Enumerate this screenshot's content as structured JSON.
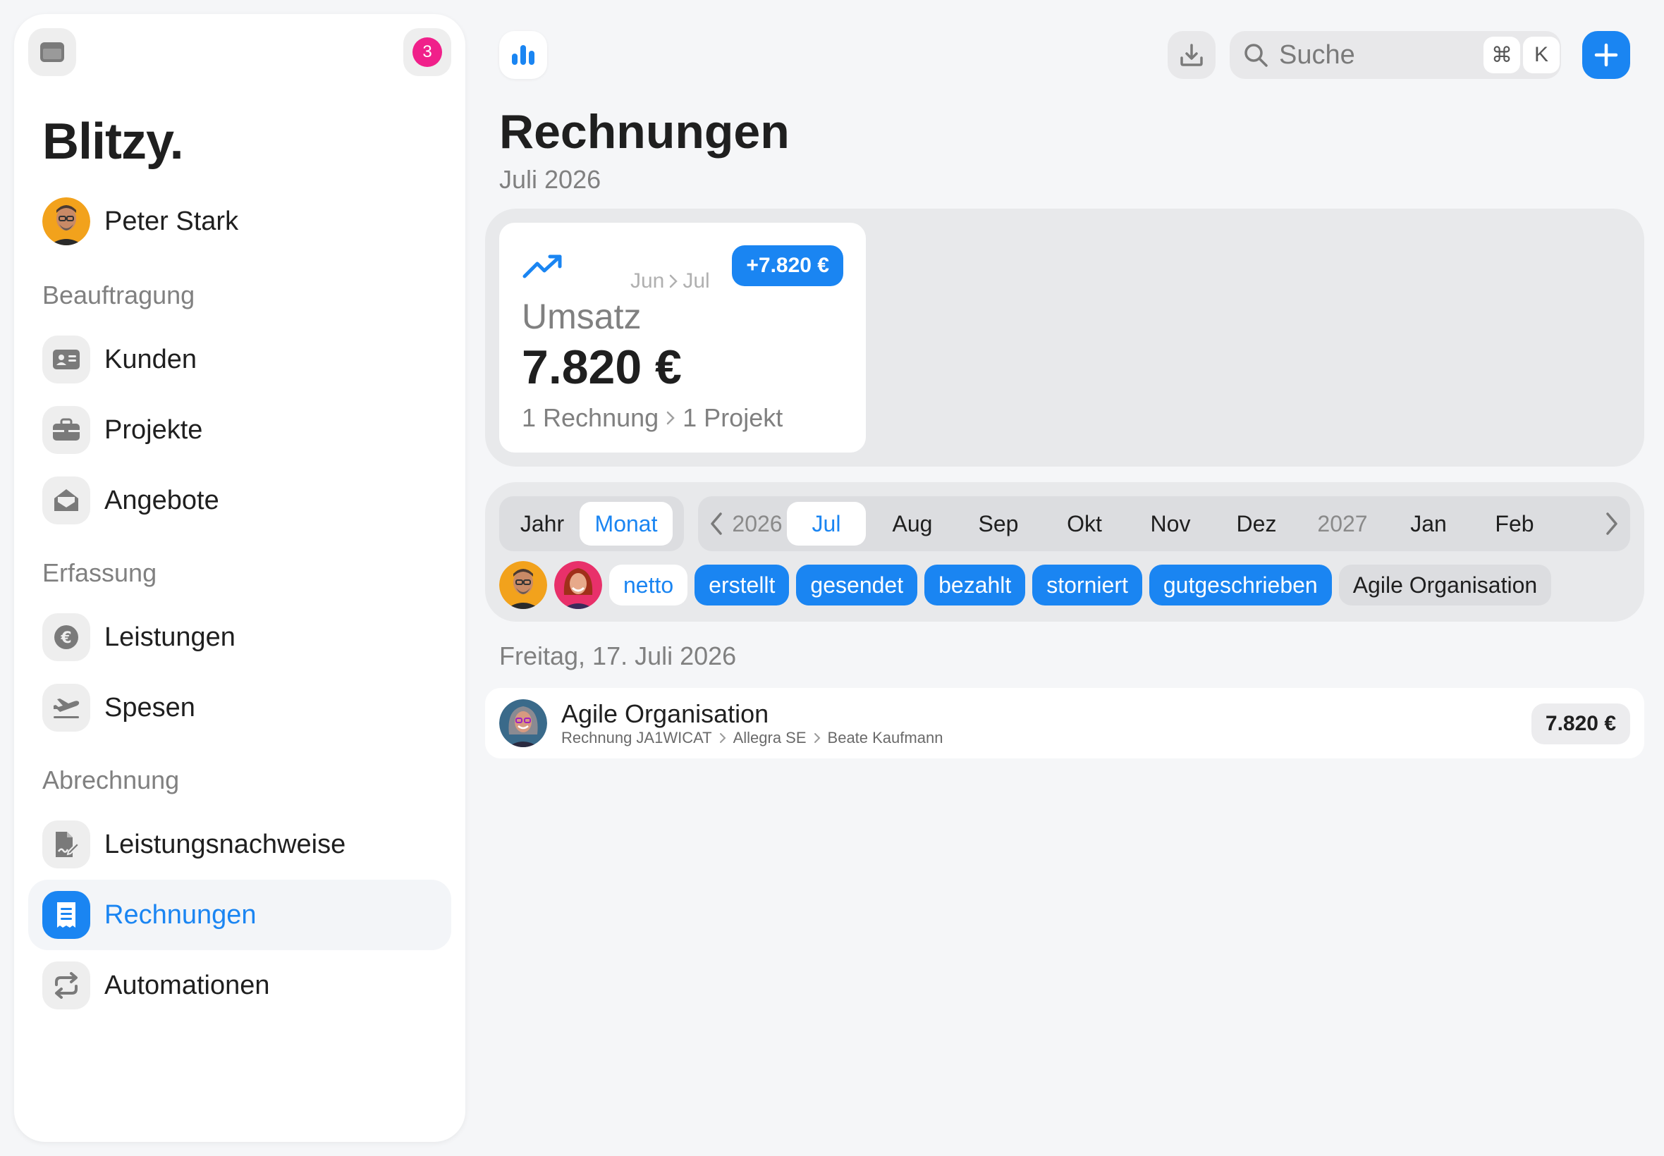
{
  "sidebar": {
    "notification_count": "3",
    "brand": "Blitzy.",
    "user_name": "Peter Stark",
    "sections": {
      "beauftragung": "Beauftragung",
      "erfassung": "Erfassung",
      "abrechnung": "Abrechnung"
    },
    "items": {
      "kunden": "Kunden",
      "projekte": "Projekte",
      "angebote": "Angebote",
      "leistungen": "Leistungen",
      "spesen": "Spesen",
      "leistungsnachweise": "Leistungsnachweise",
      "rechnungen": "Rechnungen",
      "automationen": "Automationen"
    },
    "active_item": "rechnungen"
  },
  "topbar": {
    "search_placeholder": "Suche",
    "shortcut_modifier": "⌘",
    "shortcut_key": "K"
  },
  "header": {
    "title": "Rechnungen",
    "subtitle": "Juli 2026"
  },
  "kpi": {
    "period_from": "Jun",
    "period_to": "Jul",
    "delta": "+7.820 €",
    "label": "Umsatz",
    "value": "7.820 €",
    "count_invoices": "1 Rechnung",
    "count_projects": "1 Projekt"
  },
  "filters": {
    "granularity": [
      "Jahr",
      "Monat"
    ],
    "selected_granularity": "Monat",
    "months": [
      "2026",
      "Jul",
      "Aug",
      "Sep",
      "Okt",
      "Nov",
      "Dez",
      "2027",
      "Jan",
      "Feb"
    ],
    "selected_month": "Jul",
    "chips": {
      "netto": "netto",
      "erstellt": "erstellt",
      "gesendet": "gesendet",
      "bezahlt": "bezahlt",
      "storniert": "storniert",
      "gutgeschrieben": "gutgeschrieben",
      "customer": "Agile Organisation"
    }
  },
  "list": {
    "date_header": "Freitag, 17. Juli 2026",
    "rows": [
      {
        "title": "Agile Organisation",
        "invoice": "Rechnung JA1WICAT",
        "company": "Allegra SE",
        "person": "Beate Kaufmann",
        "amount": "7.820 €"
      }
    ]
  },
  "colors": {
    "accent": "#1a85f2",
    "badge": "#f0208a",
    "background": "#f5f6f8",
    "panel": "#e8e9eb"
  },
  "icons": [
    "window-icon",
    "chart-bars-icon",
    "download-icon",
    "search-icon",
    "plus-icon",
    "trend-up-icon",
    "chevron-right-icon",
    "chevron-left-icon",
    "id-card-icon",
    "briefcase-icon",
    "envelope-open-icon",
    "euro-coin-icon",
    "plane-icon",
    "signed-document-icon",
    "receipt-icon",
    "repeat-icon"
  ]
}
